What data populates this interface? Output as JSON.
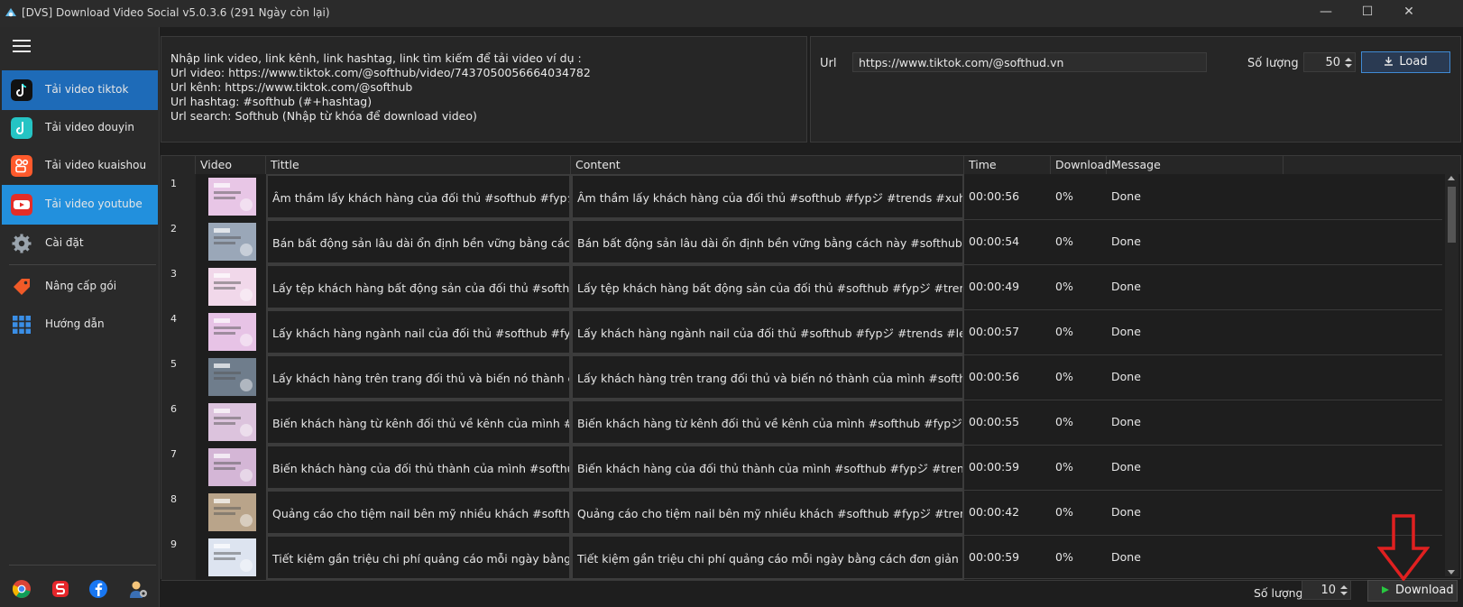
{
  "window": {
    "title": "[DVS] Download Video Social v5.0.3.6 (291 Ngày còn lại)",
    "min": "—",
    "max": "☐",
    "close": "✕"
  },
  "sidebar": {
    "items": [
      {
        "label": "Tải video tiktok",
        "icon": "tiktok-icon",
        "color": "#111111"
      },
      {
        "label": "Tải video douyin",
        "icon": "douyin-icon",
        "color": "#25c4c4"
      },
      {
        "label": "Tải video kuaishou",
        "icon": "kuaishou-icon",
        "color": "#ff5a2c"
      },
      {
        "label": "Tải video youtube",
        "icon": "youtube-icon",
        "color": "#e52d27"
      },
      {
        "label": "Cài đặt",
        "icon": "gear-icon",
        "color": "#9aa4ad"
      },
      {
        "label": "Nâng cấp gói",
        "icon": "tag-icon",
        "color": "#f05a28"
      },
      {
        "label": "Hướng dẫn",
        "icon": "grid-icon",
        "color": "#3a8ee6"
      }
    ],
    "social": [
      "chrome-icon",
      "softhub-icon",
      "facebook-icon",
      "support-icon"
    ]
  },
  "info": {
    "lines": [
      "Nhập link video, link kênh, link hashtag, link tìm kiếm để tải video ví dụ :",
      "Url video: https://www.tiktok.com/@softhub/video/7437050056664034782",
      "Url kênh: https://www.tiktok.com/@softhub",
      "Url hashtag: #softhub (#+hashtag)",
      "Url search: Softhub (Nhập từ khóa để download video)"
    ]
  },
  "url_panel": {
    "label": "Url",
    "value": "https://www.tiktok.com/@softhud.vn",
    "qty_label": "Số lượng",
    "qty_value": "50",
    "load_label": "Load"
  },
  "table": {
    "headers": [
      "Video",
      "Tittle",
      "Content",
      "Time",
      "Download",
      "Message"
    ],
    "rows": [
      {
        "n": "1",
        "title": "Âm thầm lấy khách hàng của đối thủ #softhub #fypジ #trends",
        "content": "Âm thầm lấy khách hàng của đối thủ #softhub #fypジ #trends #xuhuongtiktok",
        "time": "00:00:56",
        "dl": "0%",
        "msg": "Done",
        "thumb": "#e8c6e6"
      },
      {
        "n": "2",
        "title": "Bán bất động sản lâu dài ổn định bền vững bằng cách này #softhub",
        "content": "Bán bất động sản lâu dài ổn định bền vững bằng cách này #softhub #fypジ #trends",
        "time": "00:00:54",
        "dl": "0%",
        "msg": "Done",
        "thumb": "#9aa7b8"
      },
      {
        "n": "3",
        "title": "Lấy tệp khách hàng bất động sản của đối thủ #softhub #fypジ",
        "content": "Lấy tệp khách hàng bất động sản của đối thủ #softhub #fypジ #trends #learnontiktok",
        "time": "00:00:49",
        "dl": "0%",
        "msg": "Done",
        "thumb": "#f1d8ea"
      },
      {
        "n": "4",
        "title": "Lấy khách hàng ngành nail của đối thủ #softhub #fypジ #trends",
        "content": "Lấy khách hàng ngành nail của đối thủ #softhub #fypジ #trends #learnontiktok",
        "time": "00:00:57",
        "dl": "0%",
        "msg": "Done",
        "thumb": "#e7c3e6"
      },
      {
        "n": "5",
        "title": "Lấy khách hàng trên trang đối thủ và biến nó thành của mình #softhub",
        "content": "Lấy khách hàng trên trang đối thủ và biến nó thành của mình #softhub #fypジ #trends",
        "time": "00:00:56",
        "dl": "0%",
        "msg": "Done",
        "thumb": "#6f7d8c"
      },
      {
        "n": "6",
        "title": "Biến khách hàng từ kênh đối thủ về kênh của mình #softhub #fypジ",
        "content": "Biến khách hàng từ kênh đối thủ về kênh của mình #softhub #fypジ #trends #learnontiktok",
        "time": "00:00:55",
        "dl": "0%",
        "msg": "Done",
        "thumb": "#dcc3dd"
      },
      {
        "n": "7",
        "title": "Biến khách hàng của đối thủ thành của mình #softhub #fypジ #trends",
        "content": "Biến khách hàng của đối thủ thành của mình #softhub #fypジ #trends #learnontiktok",
        "time": "00:00:59",
        "dl": "0%",
        "msg": "Done",
        "thumb": "#d4b6d6"
      },
      {
        "n": "8",
        "title": "Quảng cáo cho tiệm nail bên mỹ nhiều khách #softhub #fypジ #trends",
        "content": "Quảng cáo cho tiệm nail bên mỹ nhiều khách #softhub #fypジ #trends #learnontiktok",
        "time": "00:00:42",
        "dl": "0%",
        "msg": "Done",
        "thumb": "#b9a48a"
      },
      {
        "n": "9",
        "title": "Tiết kiệm gần triệu chi phí quảng cáo mỗi ngày bằng cách đơn giản sau",
        "content": "Tiết kiệm gần triệu chi phí quảng cáo mỗi ngày bằng cách đơn giản sau #softhub #fypジ",
        "time": "00:00:59",
        "dl": "0%",
        "msg": "Done",
        "thumb": "#dde4f0"
      }
    ]
  },
  "footer": {
    "qty_label": "Số lượng",
    "qty_value": "10",
    "download_label": "Download"
  },
  "colors": {
    "accent": "#1e6bb8",
    "arrow": "#e02020",
    "download_icon": "#28c840"
  }
}
